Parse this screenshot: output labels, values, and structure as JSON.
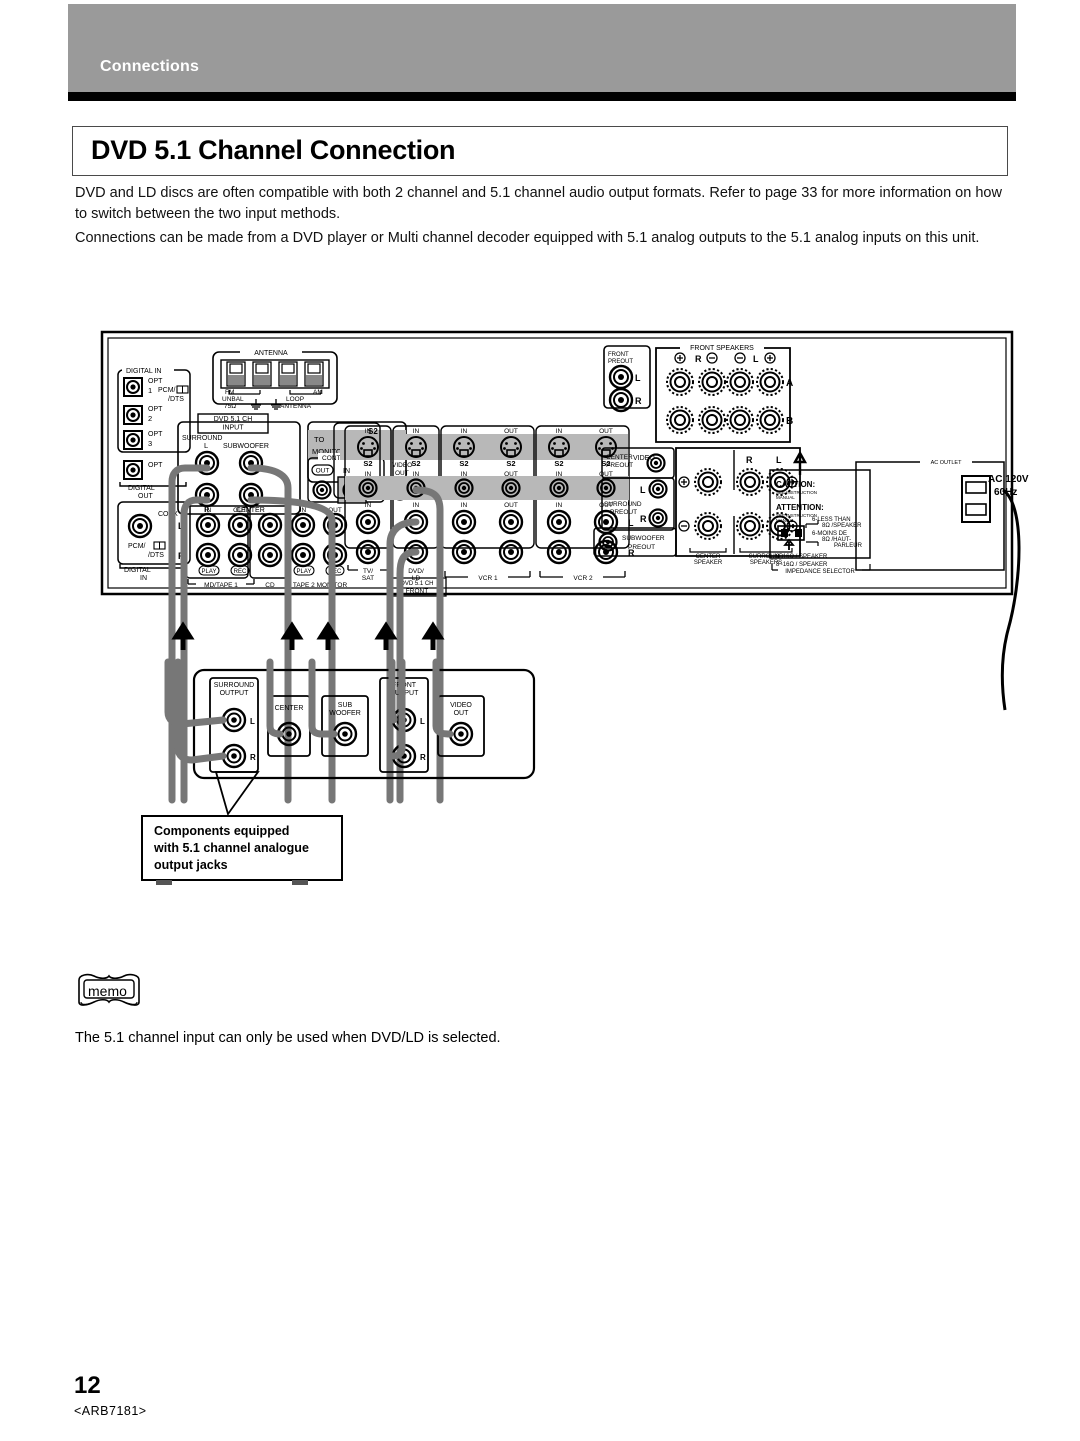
{
  "header": {
    "section_label": "Connections",
    "page_title": "DVD 5.1 Channel Connection"
  },
  "body": {
    "paragraph_1": "DVD and LD discs are often compatible with both 2 channel and 5.1 channel audio output formats. Refer to page 33 for more information on how to switch between the two input methods.",
    "paragraph_2": "Connections can be made from a DVD player or Multi channel decoder equipped with 5.1 analog outputs to the 5.1 analog inputs on this unit."
  },
  "memo": {
    "icon_label": "memo",
    "text": "The 5.1 channel input can only be used when DVD/LD is selected."
  },
  "footer": {
    "page_number": "12",
    "doc_code": "<ARB7181>"
  },
  "diagram": {
    "callout": {
      "line_1": "Components equipped",
      "line_2": "with 5.1 channel analogue",
      "line_3": "output jacks"
    },
    "antenna": {
      "group": "ANTENNA",
      "fm": "FM",
      "fm_unbal": "UNBAL",
      "fm_ohm": "75Ω",
      "am": "AM",
      "loop": "LOOP",
      "loop_antenna": "ANTENNA"
    },
    "digital_in": {
      "group": "DIGITAL IN",
      "opt_1": "OPT",
      "opt_1_num": "1",
      "opt_2": "OPT",
      "opt_2_num": "2",
      "opt_3": "OPT",
      "opt_3_num": "3",
      "format_1": "PCM/",
      "format_2": "/DTS"
    },
    "digital_out": {
      "opt": "OPT",
      "group": "DIGITAL",
      "group_2": "OUT"
    },
    "digital_in_coax": {
      "coax": "COAX",
      "format_1": "PCM/",
      "format_2": "/DTS",
      "group": "DIGITAL",
      "group_2": "IN"
    },
    "dvd_input": {
      "tag_1": "DVD 5.1 CH",
      "tag_2": "INPUT",
      "surround": "SURROUND",
      "subwoofer": "SUBWOOFER",
      "center": "CENTER",
      "left": "L",
      "right": "R"
    },
    "monitor": {
      "to": "TO",
      "monitor_tv": "MONITOR TV",
      "s2": "S2",
      "out": "OUT"
    },
    "control": {
      "group": "CONTROL",
      "out": "OUT",
      "in": "IN"
    },
    "video_out": {
      "video": "VIDEO",
      "out": "OUT"
    },
    "video_label": "VIDEO",
    "audio_rows": {
      "left": "L",
      "right": "R"
    },
    "jack_groups": [
      {
        "name": "MD/TAPE 1",
        "in": "IN",
        "out": "OUT",
        "play": "PLAY",
        "rec": "REC"
      },
      {
        "name": "CD",
        "in": "IN",
        "out": "",
        "play": "",
        "rec": ""
      },
      {
        "name": "TAPE 2 MONITOR",
        "in": "IN",
        "out": "OUT",
        "play": "PLAY",
        "rec": "REC"
      },
      {
        "name": "TV/ SAT",
        "in": "IN",
        "out": "",
        "play": "",
        "rec": ""
      },
      {
        "name": "DVD/ LD",
        "in": "IN",
        "out": "",
        "play": "",
        "rec": ""
      },
      {
        "name": "VCR 1",
        "in": "IN",
        "out": "OUT",
        "play": "",
        "rec": ""
      },
      {
        "name": "VCR 2",
        "in": "IN",
        "out": "OUT",
        "play": "",
        "rec": ""
      }
    ],
    "dvd_front_tag": {
      "line_1": "DVD 5.1 CH",
      "line_2": "FRONT"
    },
    "s2_labels": [
      "IN",
      "IN",
      "IN",
      "OUT",
      "IN",
      "OUT"
    ],
    "s2_name": "S2",
    "front_preout": {
      "group_1": "FRONT",
      "group_2": "PREOUT",
      "left": "L",
      "right": "R"
    },
    "front_speakers": {
      "group": "FRONT SPEAKERS",
      "right": "R",
      "left": "L",
      "row_a": "A",
      "row_b": "B",
      "plus": "+",
      "minus": "–"
    },
    "center_preout": {
      "line_1": "CENTER",
      "line_2": "PREOUT"
    },
    "surround_preout": {
      "line_1": "SURROUND",
      "line_2": "PREOUT",
      "left": "L",
      "right": "R"
    },
    "subwoofer_preout": {
      "line_1": "SUBWOOFER",
      "line_2": "PREOUT"
    },
    "center_speaker": {
      "line_1": "CENTER",
      "line_2": "SPEAKER"
    },
    "surround_speakers": {
      "line_1": "SURROUND",
      "line_2": "SPEAKERS",
      "right": "R",
      "left": "L"
    },
    "impedance": {
      "caution": "CAUTION:",
      "caution_sub_1": "SEE INSTRUCTION",
      "caution_sub_2": "MANUAL",
      "attention": "ATTENTION:",
      "attention_sub_1": "SEE INSTRUCTION",
      "attention_sub_2": "MANUAL",
      "less_than": "6-LESS THAN",
      "less_than_ohm": "8Ω /SPEAKER",
      "moins_de": "6-MOINS DE",
      "moins_de_ohm": "8Ω /HAUT-",
      "parleur": "PARLEUR",
      "range_1": "8~16Ω / SPEAKER",
      "range_2": "8~16Ω / SPEAKER",
      "selector": "IMPEDANCE SELECTOR"
    },
    "ac_outlet": {
      "group": "AC OUTLET",
      "volts": "AC 120V",
      "hz": "60Hz"
    },
    "device_jacks": {
      "surround_output": {
        "line_1": "SURROUND",
        "line_2": "OUTPUT",
        "left": "L",
        "right": "R"
      },
      "center": "CENTER",
      "subwoofer": {
        "line_1": "SUB",
        "line_2": "WOOFER"
      },
      "front_output": {
        "line_1": "FRONT",
        "line_2": "OUTPUT",
        "left": "L",
        "right": "R"
      },
      "video_out": {
        "line_1": "VIDEO",
        "line_2": "OUT"
      }
    }
  },
  "colors": {
    "band": "#9a9a9a",
    "rule": "#000000",
    "cable": "#777777",
    "shade": "#b8b8b8"
  }
}
